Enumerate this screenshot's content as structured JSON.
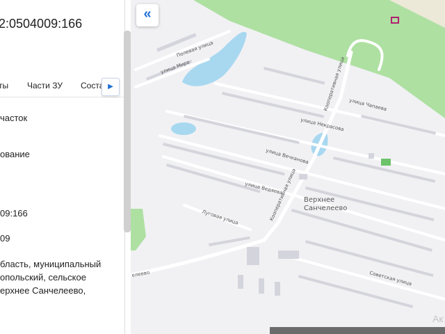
{
  "panel": {
    "title": "2:0504009:166",
    "tabs": [
      "ты",
      "Части ЗУ",
      "Соста"
    ],
    "tab_scroll_icon": "chevron-right-icon",
    "fields": [
      "часток",
      "ование",
      "09:166",
      "09"
    ],
    "address_lines": [
      "бласть, муниципальный",
      "опольский, сельское",
      "ерхнее Санчелеево,"
    ]
  },
  "map": {
    "collapse_icon": "double-chevron-left-icon",
    "village": [
      "Верхнее",
      "Санчелеево"
    ],
    "streets": {
      "polevaya": "Полевая улица",
      "mira": "улица Мира",
      "chapaeva": "улица Чапаева",
      "kooperativnaya": "Кооперативная улица",
      "nekrasova": "улица Некрасова",
      "vechkanova": "улица Вечканова",
      "vedyaeva": "улица Ведяева",
      "kooperativnaya2": "Кооперативная улица",
      "lugovaya": "Луговая улица",
      "sovetskaya": "Советская улица",
      "road_label": "елеево"
    },
    "watermark": "Ак",
    "colors": {
      "land": "#f1f1f4",
      "forest": "#aee0a2",
      "water": "#a8d8f0",
      "road": "#ffffff",
      "building": "#d4d4dc",
      "accent": "#1d6fd6"
    }
  }
}
